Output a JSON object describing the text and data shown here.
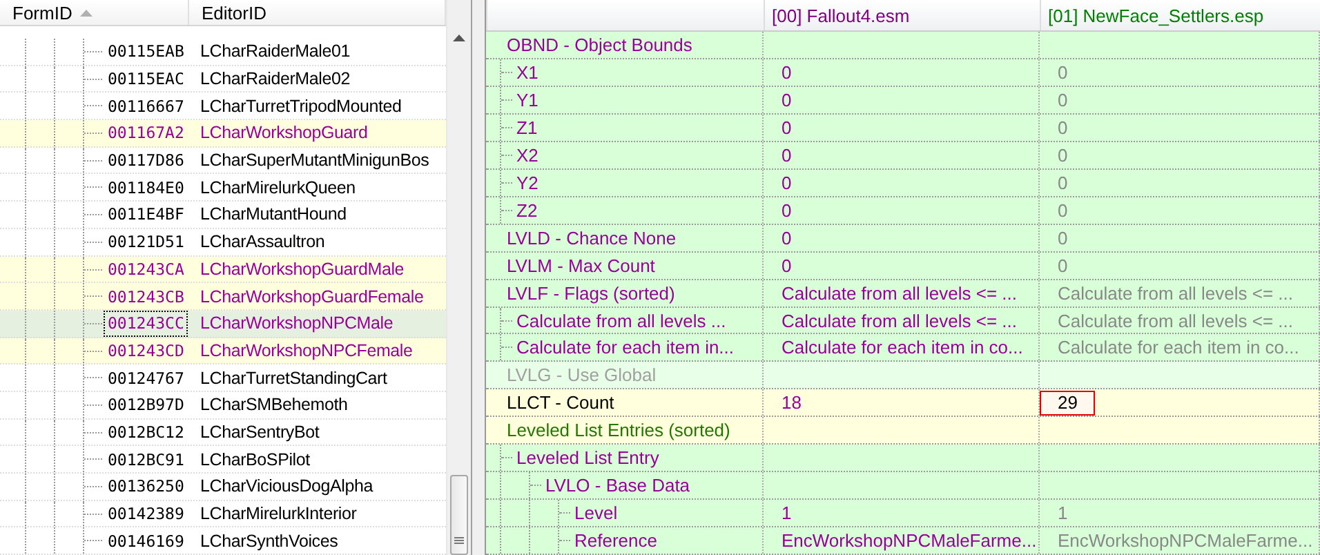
{
  "record_list": {
    "columns": [
      {
        "label": "FormID",
        "sorted": true
      },
      {
        "label": "EditorID",
        "sorted": false
      }
    ],
    "rows": [
      {
        "form_id": "00115EAB",
        "editor_id": "LCharRaiderMale01",
        "highlighted": false,
        "selected": false
      },
      {
        "form_id": "00115EAC",
        "editor_id": "LCharRaiderMale02",
        "highlighted": false,
        "selected": false
      },
      {
        "form_id": "00116667",
        "editor_id": "LCharTurretTripodMounted",
        "highlighted": false,
        "selected": false
      },
      {
        "form_id": "001167A2",
        "editor_id": "LCharWorkshopGuard",
        "highlighted": true,
        "selected": false
      },
      {
        "form_id": "00117D86",
        "editor_id": "LCharSuperMutantMinigunBos",
        "highlighted": false,
        "selected": false
      },
      {
        "form_id": "001184E0",
        "editor_id": "LCharMirelurkQueen",
        "highlighted": false,
        "selected": false
      },
      {
        "form_id": "0011E4BF",
        "editor_id": "LCharMutantHound",
        "highlighted": false,
        "selected": false
      },
      {
        "form_id": "00121D51",
        "editor_id": "LCharAssaultron",
        "highlighted": false,
        "selected": false
      },
      {
        "form_id": "001243CA",
        "editor_id": "LCharWorkshopGuardMale",
        "highlighted": true,
        "selected": false
      },
      {
        "form_id": "001243CB",
        "editor_id": "LCharWorkshopGuardFemale",
        "highlighted": true,
        "selected": false
      },
      {
        "form_id": "001243CC",
        "editor_id": "LCharWorkshopNPCMale",
        "highlighted": true,
        "selected": true
      },
      {
        "form_id": "001243CD",
        "editor_id": "LCharWorkshopNPCFemale",
        "highlighted": true,
        "selected": false
      },
      {
        "form_id": "00124767",
        "editor_id": "LCharTurretStandingCart",
        "highlighted": false,
        "selected": false
      },
      {
        "form_id": "0012B97D",
        "editor_id": "LCharSMBehemoth",
        "highlighted": false,
        "selected": false
      },
      {
        "form_id": "0012BC12",
        "editor_id": "LCharSentryBot",
        "highlighted": false,
        "selected": false
      },
      {
        "form_id": "0012BC91",
        "editor_id": "LCharBoSPilot",
        "highlighted": false,
        "selected": false
      },
      {
        "form_id": "00136250",
        "editor_id": "LCharViciousDogAlpha",
        "highlighted": false,
        "selected": false
      },
      {
        "form_id": "00142389",
        "editor_id": "LCharMirelurkInterior",
        "highlighted": false,
        "selected": false
      },
      {
        "form_id": "00146169",
        "editor_id": "LCharSynthVoices",
        "highlighted": false,
        "selected": false
      }
    ]
  },
  "record_view": {
    "columns": [
      {
        "label": "[00] Fallout4.esm",
        "color": "#800080"
      },
      {
        "label": "[01] NewFace_Settlers.esp",
        "color": "#008000"
      }
    ],
    "rows": [
      {
        "label": "OBND - Object Bounds",
        "kind": "normal",
        "children": [
          {
            "label": "X1",
            "kind": "normal",
            "marked": false,
            "values": [
              "0",
              "0"
            ]
          },
          {
            "label": "Y1",
            "kind": "normal",
            "marked": false,
            "values": [
              "0",
              "0"
            ]
          },
          {
            "label": "Z1",
            "kind": "normal",
            "marked": false,
            "values": [
              "0",
              "0"
            ]
          },
          {
            "label": "X2",
            "kind": "normal",
            "marked": false,
            "values": [
              "0",
              "0"
            ]
          },
          {
            "label": "Y2",
            "kind": "normal",
            "marked": false,
            "values": [
              "0",
              "0"
            ]
          },
          {
            "label": "Z2",
            "kind": "normal",
            "marked": false,
            "values": [
              "0",
              "0"
            ]
          }
        ]
      },
      {
        "label": "LVLD - Chance None",
        "kind": "normal",
        "marked": false,
        "values": [
          "0",
          "0"
        ]
      },
      {
        "label": "LVLM - Max Count",
        "kind": "normal",
        "marked": false,
        "values": [
          "0",
          "0"
        ]
      },
      {
        "label": "LVLF - Flags (sorted)",
        "kind": "normal",
        "marked": false,
        "values": [
          "Calculate from all levels <= ...",
          "Calculate from all levels <= ..."
        ],
        "children": [
          {
            "label": "Calculate from all levels ...",
            "kind": "normal",
            "marked": false,
            "values": [
              "Calculate from all levels <= ...",
              "Calculate from all levels <= ..."
            ]
          },
          {
            "label": "Calculate for each item in...",
            "kind": "normal",
            "marked": false,
            "values": [
              "Calculate for each item in co...",
              "Calculate for each item in co..."
            ]
          }
        ]
      },
      {
        "label": "LVLG - Use Global",
        "kind": "absent"
      },
      {
        "label": "LLCT - Count",
        "kind": "conflict",
        "marked": true,
        "values": [
          "18",
          "29"
        ]
      },
      {
        "label": "Leveled List Entries (sorted)",
        "kind": "conflict-group",
        "children": [
          {
            "label": "Leveled List Entry",
            "kind": "normal",
            "children": [
              {
                "label": "LVLO - Base Data",
                "kind": "normal",
                "children": [
                  {
                    "label": "Level",
                    "kind": "normal",
                    "marked": false,
                    "values": [
                      "1",
                      "1"
                    ]
                  },
                  {
                    "label": "Reference",
                    "kind": "normal",
                    "marked": false,
                    "values": [
                      "EncWorkshopNPCMaleFarme...",
                      "EncWorkshopNPCMaleFarme..."
                    ]
                  }
                ]
              }
            ]
          }
        ]
      }
    ]
  }
}
